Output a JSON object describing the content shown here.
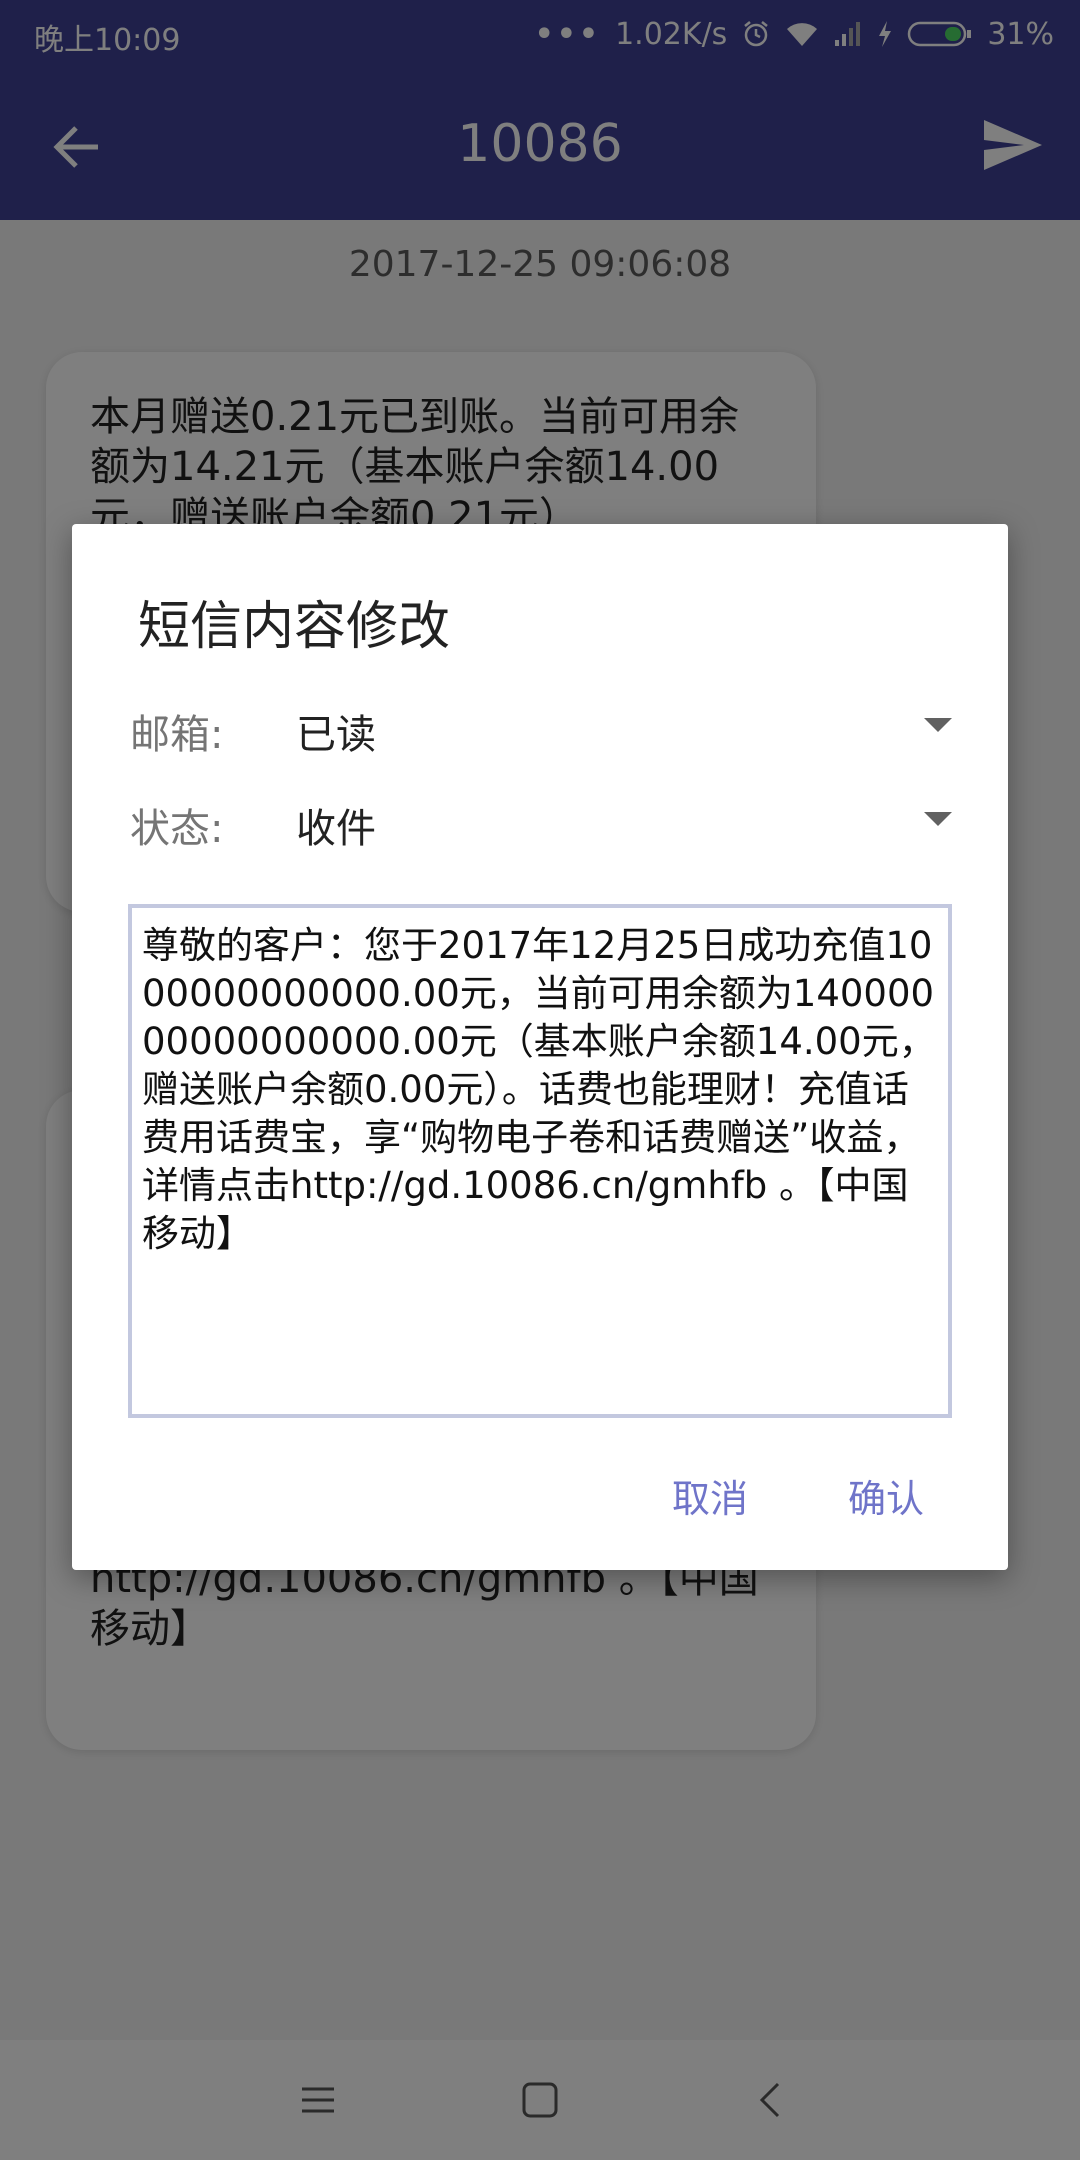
{
  "status_bar": {
    "time": "晚上10:09",
    "dots": "•••",
    "speed": "1.02K/s",
    "battery": "31%",
    "icons": [
      "alarm-icon",
      "wifi-icon",
      "signal-icon",
      "charging-icon",
      "battery-icon"
    ]
  },
  "app_bar": {
    "title": "10086",
    "back_icon": "back-arrow-icon",
    "send_icon": "send-icon",
    "color": "#3f4195"
  },
  "conversation": {
    "timestamp": "2017-12-25 09:06:08",
    "message1": "本月赠送0.21元已到账。当前可用余额为14.21元（基本账户余额14.00元，赠送账户余额0.21元）",
    "message2_tail": "http://gd.10086.cn/gmhfb 。【中国移动】"
  },
  "dialog": {
    "title": "短信内容修改",
    "mailbox_label": "邮箱:",
    "mailbox_value": "已读",
    "status_label": "状态:",
    "status_value": "收件",
    "message_text": "尊敬的客户：您于2017年12月25日成功充值1000000000000.00元，当前可用余额为14000000000000000.00元（基本账户余额14.00元，赠送账户余额0.00元）。话费也能理财！充值话费用话费宝，享“购物电子卷和话费赠送”收益，详情点击http://gd.10086.cn/gmhfb 。【中国移动】",
    "cancel": "取消",
    "confirm": "确认",
    "accent": "#6f74c9"
  },
  "nav_bar": {
    "icons": [
      "menu-icon",
      "home-icon",
      "back-icon"
    ]
  }
}
